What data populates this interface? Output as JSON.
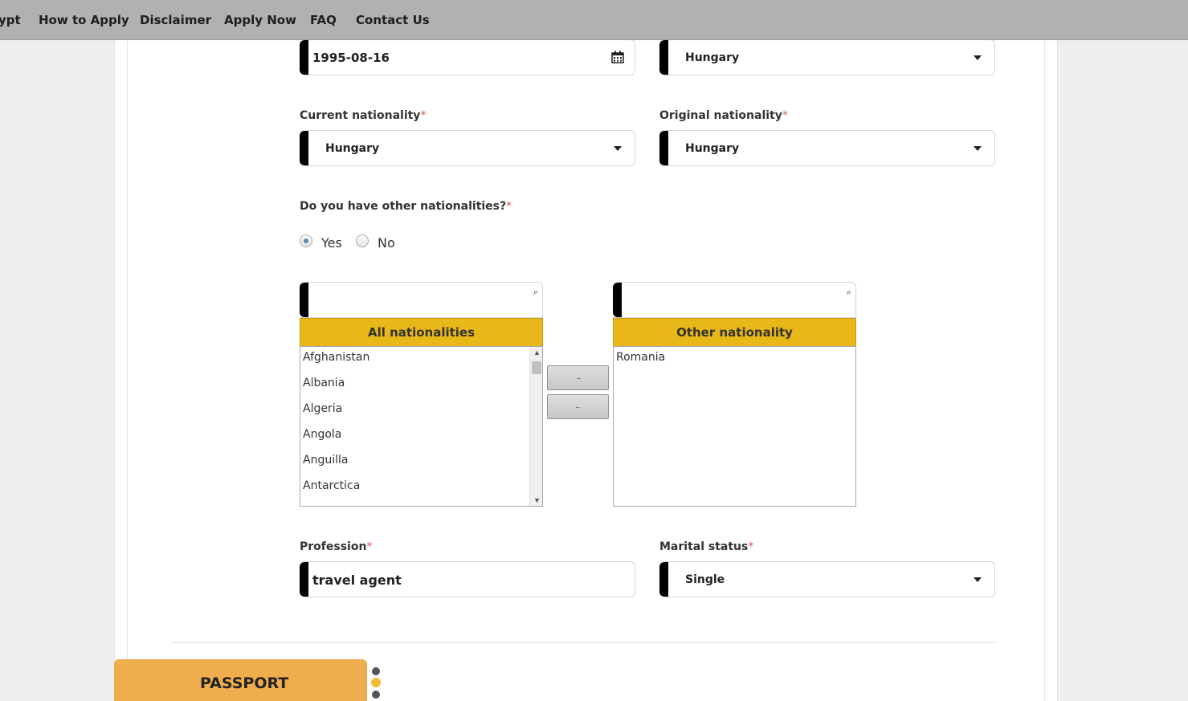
{
  "nav": {
    "items": [
      "ypt",
      "How to Apply",
      "Disclaimer",
      "Apply Now",
      "FAQ",
      "Contact Us"
    ]
  },
  "form": {
    "birth_date": "1995-08-16",
    "birth_country": "Hungary",
    "current_nationality": {
      "label": "Current nationality",
      "value": "Hungary"
    },
    "original_nationality": {
      "label": "Original nationality",
      "value": "Hungary"
    },
    "other_nationalities": {
      "question": "Do you have other nationalities?",
      "options": [
        "Yes",
        "No"
      ],
      "selected": "Yes"
    },
    "all_nationalities": {
      "header": "All nationalities",
      "search_value": "",
      "items": [
        "Afghanistan",
        "Albania",
        "Algeria",
        "Angola",
        "Anguilla",
        "Antarctica"
      ]
    },
    "selected_nationalities": {
      "header": "Other nationality",
      "search_value": "",
      "items": [
        "Romania"
      ]
    },
    "move_right_label": "→",
    "move_left_label": "←",
    "profession": {
      "label": "Profession",
      "value": "travel agent"
    },
    "marital_status": {
      "label": "Marital status",
      "value": "Single"
    },
    "required_mark": "*"
  },
  "sections": {
    "passport_label": "PASSPORT"
  },
  "icons": {
    "calendar": "calendar-icon",
    "search": "search-icon",
    "dropdown": "chevron-down-icon"
  },
  "colors": {
    "accent_yellow": "#e8b71a",
    "tab_orange": "#f0ad4e",
    "nav_gray": "#b1b1b1"
  }
}
